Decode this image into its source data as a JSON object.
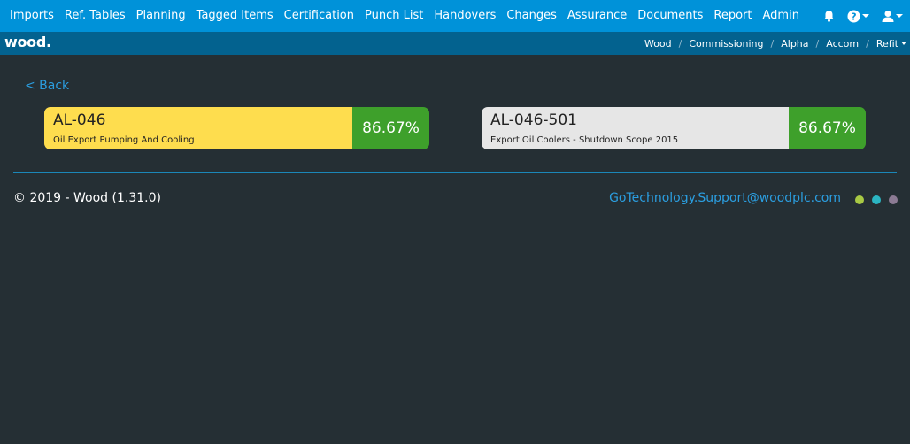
{
  "topnav": {
    "items": [
      "Imports",
      "Ref. Tables",
      "Planning",
      "Tagged Items",
      "Certification",
      "Punch List",
      "Handovers",
      "Changes",
      "Assurance",
      "Documents",
      "Report",
      "Admin"
    ],
    "icons": [
      "bell-icon",
      "help-icon",
      "user-icon"
    ]
  },
  "subnav": {
    "logo": "wood.",
    "breadcrumbs": [
      "Wood",
      "Commissioning",
      "Alpha",
      "Accom",
      "Refit"
    ]
  },
  "back_label": "< Back",
  "cards": [
    {
      "code": "AL-046",
      "description": "Oil Export Pumping And Cooling",
      "percent": "86.67%",
      "color": "#fedd4e"
    },
    {
      "code": "AL-046-501",
      "description": "Export Oil Coolers - Shutdown Scope 2015",
      "percent": "86.67%",
      "color": "#e6e6e6"
    }
  ],
  "footer": {
    "copyright": "© 2019 - Wood (1.31.0)",
    "support_email": "GoTechnology.Support@woodplc.com",
    "dot_colors": [
      "#a8c944",
      "#2bb5c2",
      "#8c7b94"
    ]
  },
  "colors": {
    "topnav": "#0092d9",
    "subnav": "#03628f",
    "background": "#252f34",
    "percent_green": "#3ea02b",
    "link": "#2b9ee0"
  }
}
